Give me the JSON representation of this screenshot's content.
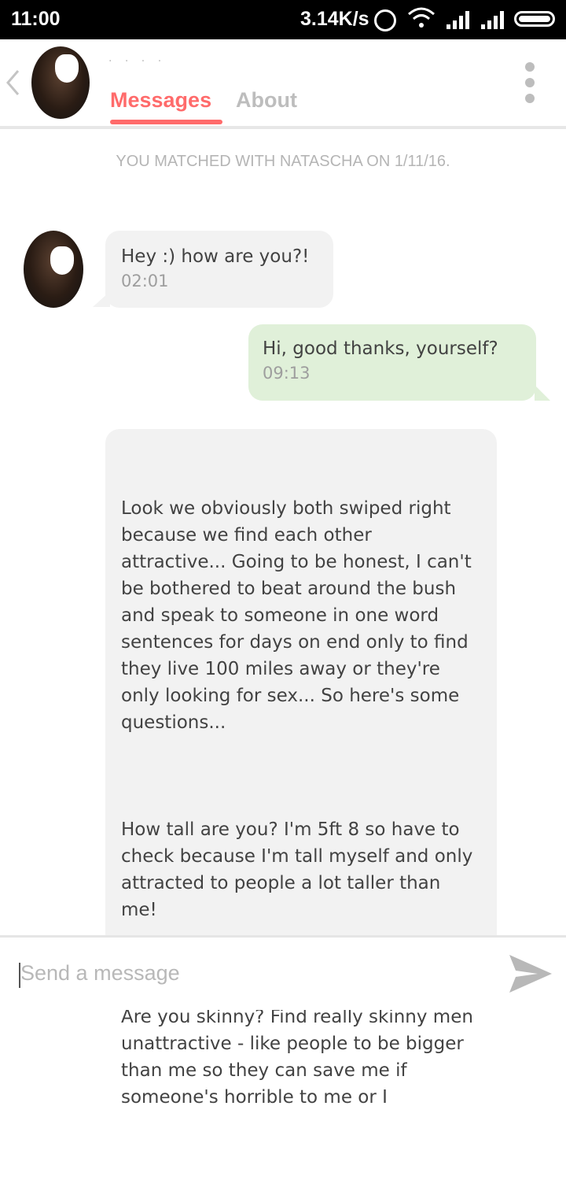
{
  "status_bar": {
    "time": "11:00",
    "network_speed": "3.14K/s",
    "icons": [
      "alarm-icon",
      "wifi-icon",
      "signal-icon",
      "signal-icon",
      "battery-icon"
    ]
  },
  "header": {
    "contact_name_obscured": "· · ·   ·",
    "tabs": [
      {
        "label": "Messages",
        "active": true
      },
      {
        "label": "About",
        "active": false
      }
    ],
    "accent_color": "#ff6b6b"
  },
  "conversation": {
    "match_notice": "YOU MATCHED WITH NATASCHA ON 1/11/16.",
    "messages": [
      {
        "direction": "incoming",
        "text": "Hey :) how are you?!",
        "time": "02:01"
      },
      {
        "direction": "outgoing",
        "text": "Hi, good thanks, yourself?",
        "time": "09:13"
      },
      {
        "direction": "incoming",
        "paragraphs": [
          "Look we obviously both swiped right because we find each other attractive... Going to be honest, I can't be bothered to beat around the bush and speak to someone in one word sentences for days on end only to find they live 100 miles away or they're only looking for sex... So here's some questions...",
          "How tall are you? I'm 5ft 8 so have to check because I'm tall myself and only attracted to people a lot taller than me!",
          "Are you skinny? Find really skinny men unattractive - like people to be bigger than me so they can save me if someone's horrible to me or I"
        ]
      }
    ]
  },
  "composer": {
    "placeholder": "Send a message"
  }
}
